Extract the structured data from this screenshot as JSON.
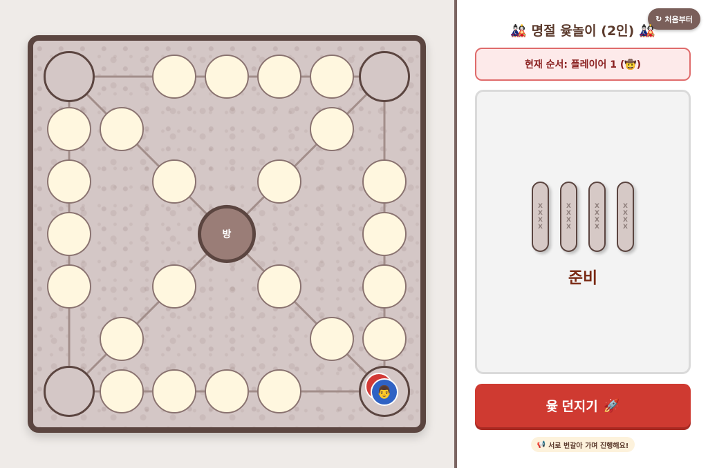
{
  "title": {
    "icon_left": "🎎",
    "text": "명절 윷놀이 (2인)",
    "icon_right": "🎎"
  },
  "controls": {
    "reset_icon": "↻",
    "reset_label": "처음부터"
  },
  "turn": {
    "label": "현재 순서: 플레이어 1 (🤠)"
  },
  "board": {
    "center_label": "방"
  },
  "yut": {
    "stick_marks": [
      "X",
      "X",
      "X",
      "X"
    ],
    "result": "준비"
  },
  "throw_button": {
    "label": "윷 던지기",
    "icon": "🚀"
  },
  "hint": {
    "icon": "📢",
    "text": "서로 번갈아 가며 진행해요!"
  },
  "pieces": {
    "player1_color": "#d23a36",
    "player2_color": "#2f62c4",
    "player2_face": "👨"
  },
  "colors": {
    "board_border": "#5b4540",
    "node_fill": "#fff7df",
    "accent_red": "#cf3a31"
  }
}
